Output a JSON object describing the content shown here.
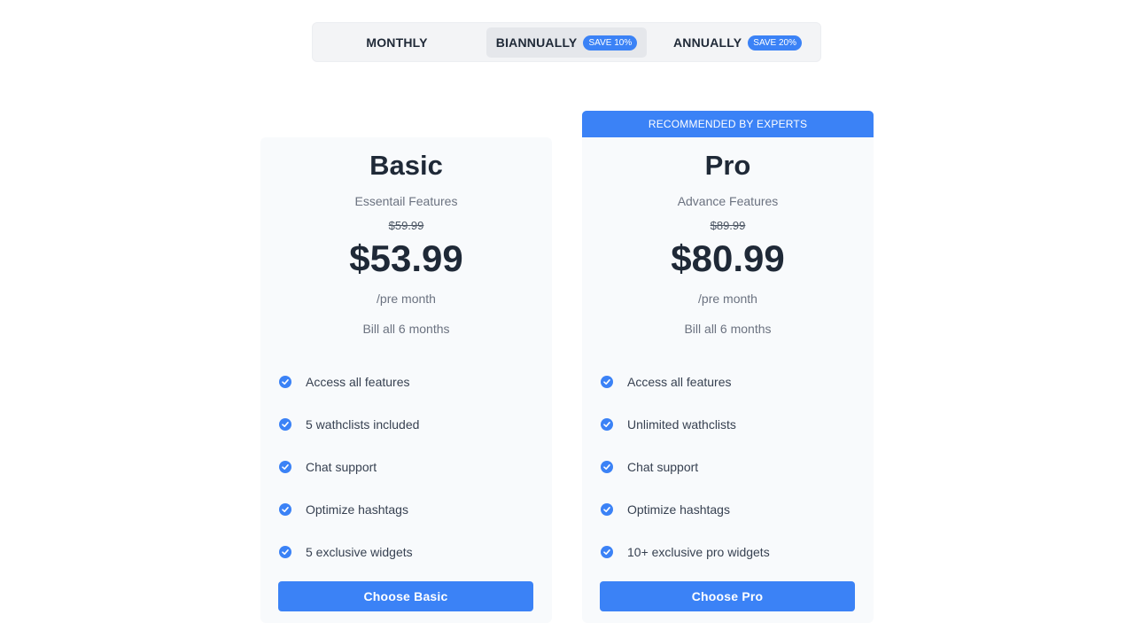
{
  "billing_toggle": {
    "options": [
      {
        "label": "MONTHLY",
        "badge": "",
        "selected": false
      },
      {
        "label": "BIANNUALLY",
        "badge": "SAVE 10%",
        "selected": true
      },
      {
        "label": "ANNUALLY",
        "badge": "SAVE 20%",
        "selected": false
      }
    ]
  },
  "colors": {
    "accent": "#3b82f6",
    "card_bg": "#f8fafc",
    "toggle_bg": "#f3f4f6"
  },
  "plans": [
    {
      "name": "Basic",
      "description": "Essentail Features",
      "old_price": "$59.99",
      "price": "$53.99",
      "period": "/pre month",
      "billing": "Bill all 6 months",
      "features": [
        "Access all features",
        "5 wathclists included",
        "Chat support",
        "Optimize hashtags",
        "5 exclusive widgets"
      ],
      "cta": "Choose Basic"
    },
    {
      "banner": "RECOMMENDED BY EXPERTS",
      "name": "Pro",
      "description": "Advance Features",
      "old_price": "$89.99",
      "price": "$80.99",
      "period": "/pre month",
      "billing": "Bill all 6 months",
      "features": [
        "Access all features",
        "Unlimited wathclists",
        "Chat support",
        "Optimize hashtags",
        "10+ exclusive pro widgets"
      ],
      "cta": "Choose Pro"
    }
  ],
  "icons": {
    "feature_check": "check-circle-icon"
  }
}
